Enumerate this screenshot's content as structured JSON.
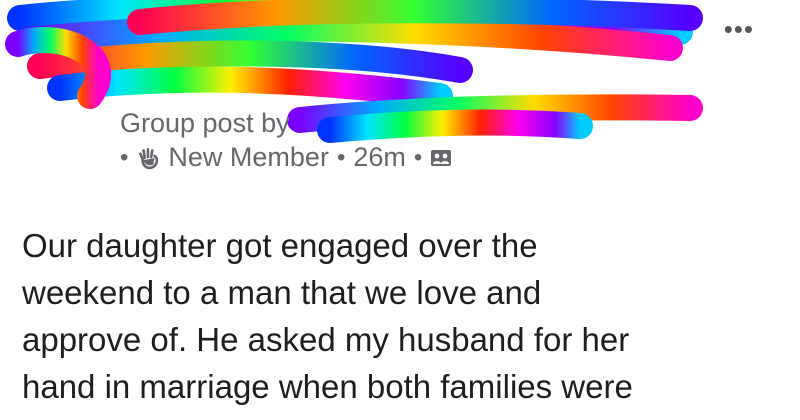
{
  "header": {
    "group_post_label": "Group post by",
    "member_badge": "New Member",
    "separator": "•",
    "timestamp": "26m",
    "icons": {
      "more": "more-options-icon",
      "badge": "waving-hand-icon",
      "audience": "group-audience-icon"
    }
  },
  "post": {
    "lines": [
      "Our daughter got engaged over the",
      "weekend to a man that we love and",
      "approve of. He asked my husband for her",
      "hand in marriage when both families were"
    ]
  }
}
